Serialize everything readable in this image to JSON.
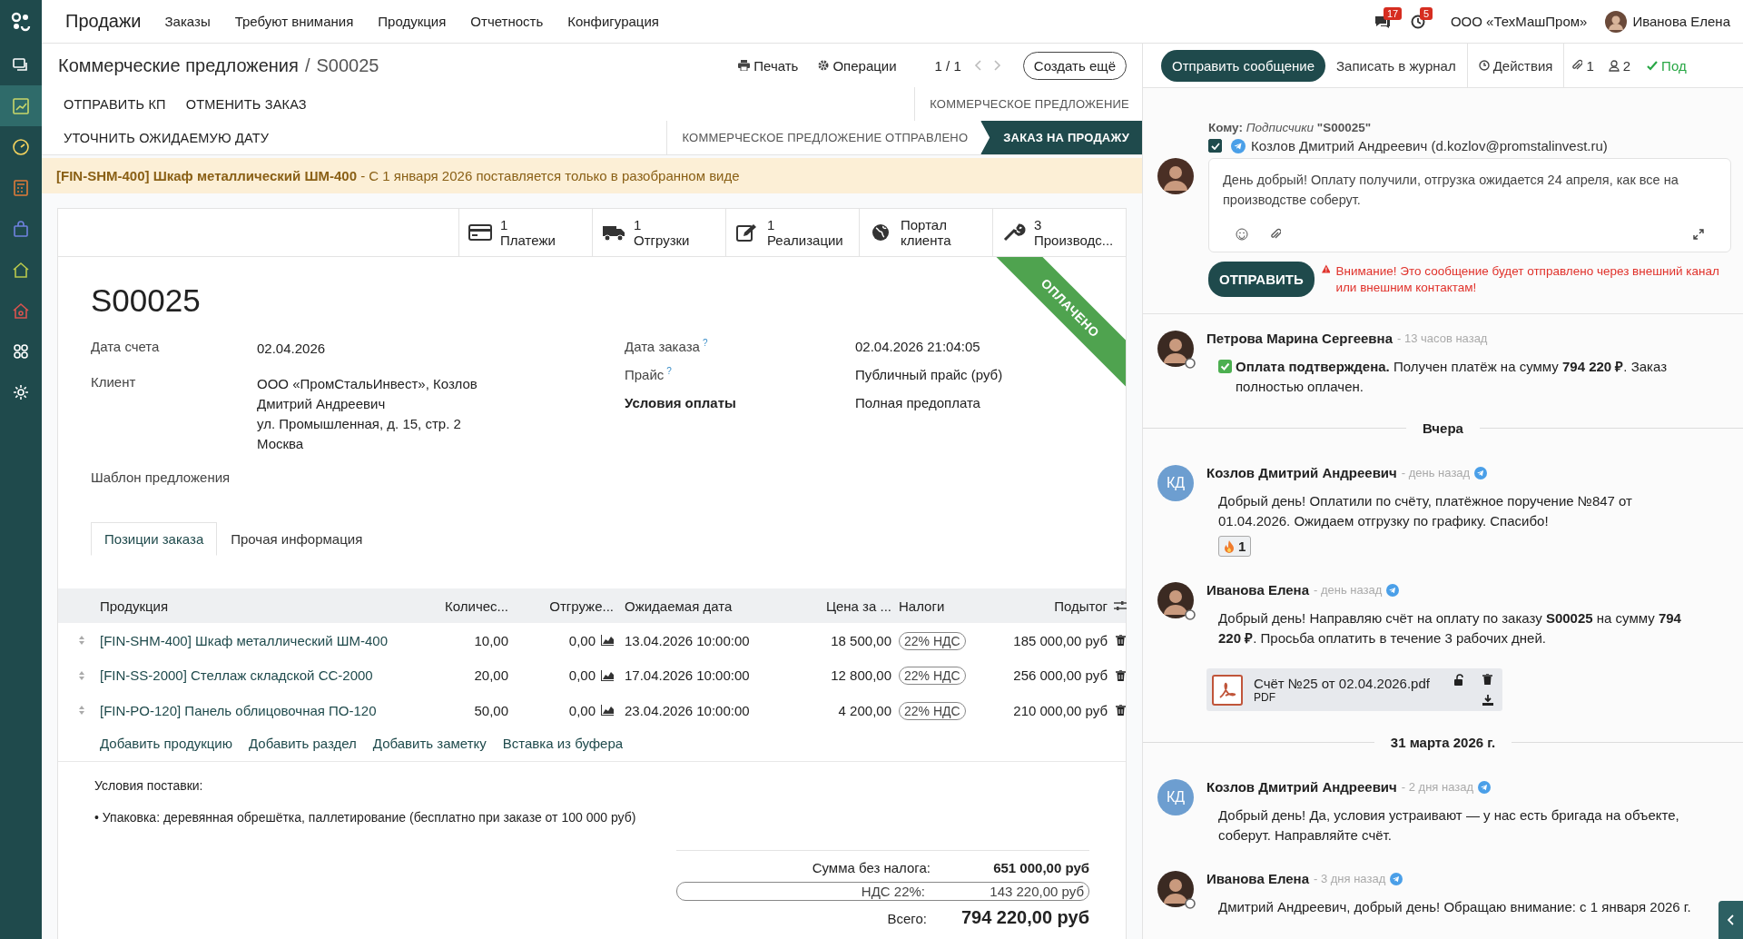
{
  "app": {
    "name": "Продажи",
    "menu": [
      "Заказы",
      "Требуют внимания",
      "Продукция",
      "Отчетность",
      "Конфигурация"
    ]
  },
  "sidebar": {
    "items": [
      {
        "kind": "chat",
        "selected": false
      },
      {
        "kind": "chart",
        "selected": true
      },
      {
        "kind": "gauge",
        "selected": false
      },
      {
        "kind": "calculator",
        "selected": false
      },
      {
        "kind": "bag",
        "selected": false
      },
      {
        "kind": "home",
        "selected": false
      },
      {
        "kind": "home-gear",
        "selected": false
      },
      {
        "kind": "apps",
        "selected": false
      },
      {
        "kind": "settings",
        "selected": false
      }
    ]
  },
  "systray": {
    "messages_count": "17",
    "activities_count": "5",
    "company": "ООО «ТехМашПром»",
    "user": "Иванова Елена"
  },
  "breadcrumb": {
    "parent": "Коммерческие предложения",
    "separator": "/",
    "current": "S00025"
  },
  "toolbar": {
    "print": "Печать",
    "actions": "Операции",
    "pager": "1 / 1",
    "create": "Создать ещё"
  },
  "action_buttons": [
    [
      "ОТПРАВИТЬ КП",
      "ОТМЕНИТЬ ЗАКАЗ"
    ],
    [
      "УТОЧНИТЬ ОЖИДАЕМУЮ ДАТУ"
    ]
  ],
  "statusbar": [
    [
      {
        "label": "КОММЕРЧЕСКОЕ ПРЕДЛОЖЕНИЕ",
        "selected": false
      }
    ],
    [
      {
        "label": "КОММЕРЧЕСКОЕ ПРЕДЛОЖЕНИЕ ОТПРАВЛЕНО",
        "selected": false
      },
      {
        "label": "ЗАКАЗ НА ПРОДАЖУ",
        "selected": true
      }
    ]
  ],
  "alert": "**[FIN-SHM-400] Шкаф металлический ШМ-400** - С 1 января 2026 поставляется только в разобранном виде",
  "smart_buttons": [
    {
      "kind": "payments",
      "count": "1",
      "label": "Платежи"
    },
    {
      "kind": "delivery",
      "count": "1",
      "label": "Отгрузки"
    },
    {
      "kind": "invoice",
      "count": "1",
      "label": "Реализации"
    },
    {
      "kind": "portal",
      "label": "Портал клиента"
    },
    {
      "kind": "manufacturing",
      "count": "3",
      "label": "Производс..."
    }
  ],
  "ribbon": "ОПЛАЧЕНО",
  "order_name": "S00025",
  "fields_left": [
    {
      "label": "Дата счета",
      "lines": [
        "02.04.2026"
      ]
    },
    {
      "label": "Клиент",
      "lines": [
        "ООО «ПромСтальИнвест», Козлов Дмитрий Андреевич",
        "ул. Промышленная, д. 15, стр. 2",
        "Москва"
      ]
    },
    {
      "label": "Шаблон предложения"
    }
  ],
  "fields_right": [
    {
      "label": "Дата заказа",
      "help": "?",
      "required": false,
      "value": "02.04.2026 21:04:05"
    },
    {
      "label": "Прайс",
      "help": "?",
      "required": false,
      "value": "Публичный прайс (руб)"
    },
    {
      "label": "Условия оплаты",
      "required": true,
      "value": "Полная предоплата"
    }
  ],
  "tabs": [
    {
      "label": "Позиции заказа",
      "selected": true
    },
    {
      "label": "Прочая информация",
      "selected": false
    }
  ],
  "table": {
    "columns": [
      "Продукция",
      "Количес...",
      "Отгруже...",
      "Ожидаемая дата",
      "Цена за ...",
      "Налоги",
      "Подытог"
    ],
    "rows": [
      {
        "product": "[FIN-SHM-400] Шкаф металлический ШМ-400",
        "qty": "10,00",
        "delivered": "0,00",
        "date": "13.04.2026 10:00:00",
        "price": "18 500,00",
        "tax": "22% НДС",
        "subtotal": "185 000,00 руб"
      },
      {
        "product": "[FIN-SS-2000] Стеллаж складской СС-2000",
        "qty": "20,00",
        "delivered": "0,00",
        "date": "17.04.2026 10:00:00",
        "price": "12 800,00",
        "tax": "22% НДС",
        "subtotal": "256 000,00 руб"
      },
      {
        "product": "[FIN-PO-120] Панель облицовочная ПО-120",
        "qty": "50,00",
        "delivered": "0,00",
        "date": "23.04.2026 10:00:00",
        "price": "4 200,00",
        "tax": "22% НДС",
        "subtotal": "210 000,00 руб"
      }
    ]
  },
  "add_links": [
    "Добавить продукцию",
    "Добавить раздел",
    "Добавить заметку",
    "Вставка из буфера"
  ],
  "note": {
    "title": "Условия поставки:",
    "items": [
      "• Упаковка: деревянная обрешётка, паллетирование (бесплатно при заказе от 100 000 руб)"
    ]
  },
  "totals": [
    {
      "kind": "untaxed",
      "label": "Сумма без налога:",
      "value": "651 000,00 руб"
    },
    {
      "kind": "tax",
      "label": "НДС 22%:",
      "value": "143 220,00 руб"
    },
    {
      "kind": "total",
      "label": "Всего:",
      "value": "794 220,00 руб"
    }
  ],
  "chatter": {
    "send": "Отправить сообщение",
    "log": "Записать в журнал",
    "activities": "Действия",
    "attachments": "1",
    "followers": "2",
    "follow": "Под"
  },
  "composer": {
    "to": "**Кому:** *Подписчики* **\"S00025\"**",
    "recipient": {
      "checked": true,
      "label": "Козлов Дмитрий Андреевич (d.kozlov@promstalinvest.ru)"
    },
    "text": "День добрый! Оплату получили, отгрузка ожидается 24 апреля, как все на производстве соберут.",
    "send": "ОТПРАВИТЬ",
    "warning": "Внимание! Это сообщение будет отправлено через внешний канал или внешним контактам!"
  },
  "thread": [
    {
      "kind": "message",
      "author": "Петрова Марина Сергеевна",
      "time": "- 13 часов назад",
      "avatar": {
        "kind": "photo"
      },
      "telegram": false,
      "confirmed": true,
      "body": "**Оплата подтверждена.** Получен платёж на сумму **794 220 ₽**. Заказ полностью оплачен."
    },
    {
      "kind": "separator",
      "label": "Вчера"
    },
    {
      "kind": "message",
      "author": "Козлов Дмитрий Андреевич",
      "time": "- день назад",
      "avatar": {
        "kind": "initials"
      },
      "initials": "КД",
      "telegram": true,
      "body": "Добрый день! Оплатили по счёту, платёжное поручение №847 от 01.04.2026. Ожидаем отгрузку по графику. Спасибо!",
      "reaction": {
        "count": "1"
      }
    },
    {
      "kind": "message",
      "author": "Иванова Елена",
      "time": "- день назад",
      "avatar": {
        "kind": "photo"
      },
      "telegram": true,
      "body": "Добрый день! Направляю счёт на оплату по заказу **S00025** на сумму **794 220 ₽**. Просьба оплатить в течение 3 рабочих дней.",
      "attachment": {
        "name": "Счёт №25 от 02.04.2026.pdf",
        "type": "PDF"
      }
    },
    {
      "kind": "separator",
      "label": "31 марта 2026 г."
    },
    {
      "kind": "message",
      "author": "Козлов Дмитрий Андреевич",
      "time": "- 2 дня назад",
      "avatar": {
        "kind": "initials"
      },
      "initials": "КД",
      "telegram": true,
      "body": "Добрый день! Да, условия устраивают — у нас есть бригада на объекте, соберут. Направляйте счёт."
    },
    {
      "kind": "message",
      "author": "Иванова Елена",
      "time": "- 3 дня назад",
      "avatar": {
        "kind": "photo"
      },
      "telegram": true,
      "body": "Дмитрий Андреевич, добрый день! Обращаю внимание: с 1 января 2026 г."
    }
  ]
}
